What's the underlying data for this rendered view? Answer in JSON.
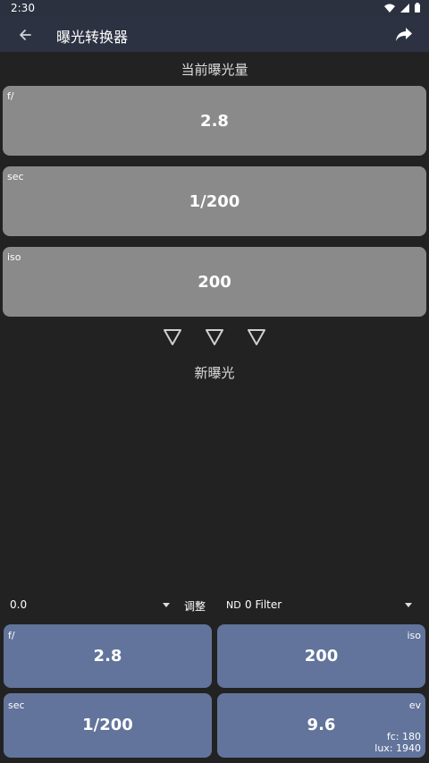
{
  "status_bar": {
    "time": "2:30"
  },
  "app_bar": {
    "title": "曝光转换器"
  },
  "current": {
    "title": "当前曝光量",
    "aperture": {
      "label": "f/",
      "value": "2.8"
    },
    "shutter": {
      "label": "sec",
      "value": "1/200"
    },
    "iso": {
      "label": "iso",
      "value": "200"
    }
  },
  "new_section": {
    "title": "新曝光"
  },
  "controls": {
    "ev_adjust_value": "0.0",
    "adjust_label": "调整",
    "nd_label": "ND",
    "nd_value": "0 Filter"
  },
  "results": {
    "aperture": {
      "label": "f/",
      "value": "2.8"
    },
    "iso": {
      "label": "iso",
      "value": "200"
    },
    "shutter": {
      "label": "sec",
      "value": "1/200"
    },
    "ev": {
      "label": "ev",
      "value": "9.6",
      "fc": "fc: 180",
      "lux": "lux: 1940"
    }
  },
  "colors": {
    "app_bar": "#2d3242",
    "background": "#222222",
    "input_card": "#8a8a8a",
    "result_card": "#62749b"
  },
  "icons": [
    "wifi-icon",
    "signal-icon",
    "battery-icon",
    "back-arrow-icon",
    "share-icon",
    "triangle-down-icon"
  ]
}
